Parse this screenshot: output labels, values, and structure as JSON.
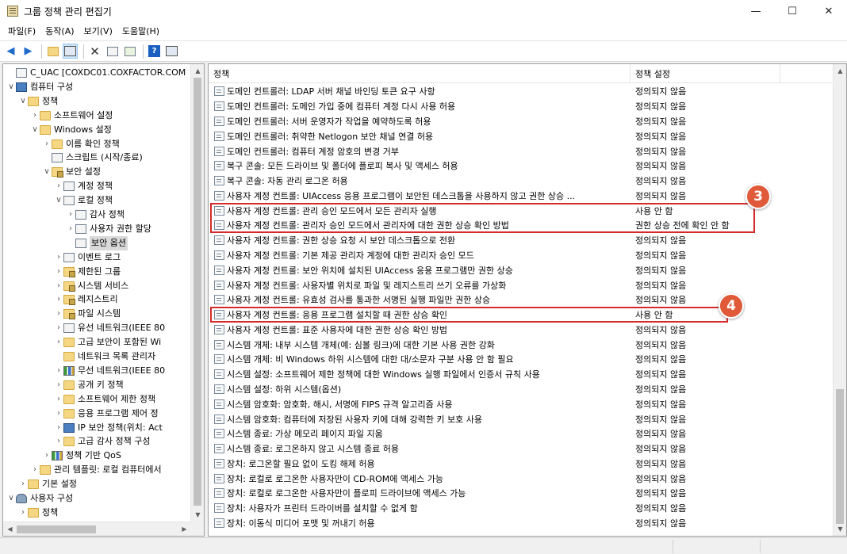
{
  "window": {
    "title": "그룹 정책 관리 편집기",
    "minimize": "—",
    "maximize": "☐",
    "close": "✕"
  },
  "menu": [
    {
      "label": "파일(F)"
    },
    {
      "label": "동작(A)"
    },
    {
      "label": "보기(V)"
    },
    {
      "label": "도움말(H)"
    }
  ],
  "toolbar": {
    "back": "◀",
    "forward": "▶",
    "delete": "✕",
    "help": "?"
  },
  "tree": [
    {
      "label": "C_UAC [COXDC01.COXFACTOR.COM",
      "depth": 0,
      "chevron": "",
      "icon": "sheet"
    },
    {
      "label": "컴퓨터 구성",
      "depth": 0,
      "chevron": "∨",
      "icon": "monitor"
    },
    {
      "label": "정책",
      "depth": 1,
      "chevron": "∨",
      "icon": "folder"
    },
    {
      "label": "소프트웨어 설정",
      "depth": 2,
      "chevron": "›",
      "icon": "folder"
    },
    {
      "label": "Windows 설정",
      "depth": 2,
      "chevron": "∨",
      "icon": "folder"
    },
    {
      "label": "이름 확인 정책",
      "depth": 3,
      "chevron": "›",
      "icon": "folder"
    },
    {
      "label": "스크립트 (시작/종료)",
      "depth": 3,
      "chevron": "",
      "icon": "sheet"
    },
    {
      "label": "보안 설정",
      "depth": 3,
      "chevron": "∨",
      "icon": "folder-lock"
    },
    {
      "label": "계정 정책",
      "depth": 4,
      "chevron": "›",
      "icon": "sheet"
    },
    {
      "label": "로컬 정책",
      "depth": 4,
      "chevron": "∨",
      "icon": "sheet"
    },
    {
      "label": "감사 정책",
      "depth": 5,
      "chevron": "›",
      "icon": "sheet"
    },
    {
      "label": "사용자 권한 할당",
      "depth": 5,
      "chevron": "›",
      "icon": "sheet"
    },
    {
      "label": "보안 옵션",
      "depth": 5,
      "chevron": "",
      "icon": "sheet",
      "selected": true
    },
    {
      "label": "이벤트 로그",
      "depth": 4,
      "chevron": "›",
      "icon": "sheet"
    },
    {
      "label": "제한된 그룹",
      "depth": 4,
      "chevron": "›",
      "icon": "folder-lock"
    },
    {
      "label": "시스템 서비스",
      "depth": 4,
      "chevron": "›",
      "icon": "folder-lock"
    },
    {
      "label": "레지스트리",
      "depth": 4,
      "chevron": "›",
      "icon": "folder-lock"
    },
    {
      "label": "파일 시스템",
      "depth": 4,
      "chevron": "›",
      "icon": "folder-lock"
    },
    {
      "label": "유선 네트워크(IEEE 80",
      "depth": 4,
      "chevron": "›",
      "icon": "sheet"
    },
    {
      "label": "고급 보안이 포함된 Wi",
      "depth": 4,
      "chevron": "›",
      "icon": "folder"
    },
    {
      "label": "네트워크 목록 관리자",
      "depth": 4,
      "chevron": "",
      "icon": "folder"
    },
    {
      "label": "무선 네트워크(IEEE 80",
      "depth": 4,
      "chevron": "›",
      "icon": "chart"
    },
    {
      "label": "공개 키 정책",
      "depth": 4,
      "chevron": "›",
      "icon": "folder"
    },
    {
      "label": "소프트웨어 제한 정책",
      "depth": 4,
      "chevron": "›",
      "icon": "folder"
    },
    {
      "label": "응용 프로그램 제어 정",
      "depth": 4,
      "chevron": "›",
      "icon": "folder"
    },
    {
      "label": "IP 보안 정책(위치: Act",
      "depth": 4,
      "chevron": "›",
      "icon": "monitor"
    },
    {
      "label": "고급 감사 정책 구성",
      "depth": 4,
      "chevron": "›",
      "icon": "folder"
    },
    {
      "label": "정책 기반 QoS",
      "depth": 3,
      "chevron": "›",
      "icon": "chart"
    },
    {
      "label": "관리 템플릿: 로컬 컴퓨터에서",
      "depth": 2,
      "chevron": "›",
      "icon": "folder"
    },
    {
      "label": "기본 설정",
      "depth": 1,
      "chevron": "›",
      "icon": "folder"
    },
    {
      "label": "사용자 구성",
      "depth": 0,
      "chevron": "∨",
      "icon": "person"
    },
    {
      "label": "정책",
      "depth": 1,
      "chevron": "›",
      "icon": "folder"
    },
    {
      "label": "기본 설정",
      "depth": 1,
      "chevron": "›",
      "icon": "folder"
    }
  ],
  "list": {
    "columns": {
      "policy": "정책",
      "setting": "정책 설정"
    },
    "rows": [
      {
        "name": "도메인 컨트롤러: LDAP 서버 채널 바인딩 토큰 요구 사항",
        "setting": "정의되지 않음"
      },
      {
        "name": "도메인 컨트롤러: 도메인 가입 중에 컴퓨터 계정 다시 사용 허용",
        "setting": "정의되지 않음"
      },
      {
        "name": "도메인 컨트롤러: 서버 운영자가 작업을 예약하도록 허용",
        "setting": "정의되지 않음"
      },
      {
        "name": "도메인 컨트롤러: 취약한 Netlogon 보안 채널 연결 허용",
        "setting": "정의되지 않음"
      },
      {
        "name": "도메인 컨트롤러: 컴퓨터 계정 암호의 변경 거부",
        "setting": "정의되지 않음"
      },
      {
        "name": "복구 콘솔: 모든 드라이브 및 폴더에 플로피 복사 및 액세스 허용",
        "setting": "정의되지 않음"
      },
      {
        "name": "복구 콘솔: 자동 관리 로그온 허용",
        "setting": "정의되지 않음"
      },
      {
        "name": "사용자 계정 컨트롤: UIAccess 응용 프로그램이 보안된 데스크톱을 사용하지 않고 권한 상승 ...",
        "setting": "정의되지 않음"
      },
      {
        "name": "사용자 계정 컨트롤: 관리 승인 모드에서 모든 관리자 실행",
        "setting": "사용 안 함"
      },
      {
        "name": "사용자 계정 컨트롤: 관리자 승인 모드에서 관리자에 대한 권한 상승 확인 방법",
        "setting": "권한 상승 전에 확인 안 함"
      },
      {
        "name": "사용자 계정 컨트롤: 권한 상승 요청 시 보안 데스크톱으로 전환",
        "setting": "정의되지 않음"
      },
      {
        "name": "사용자 계정 컨트롤: 기본 제공 관리자 계정에 대한 관리자 승인 모드",
        "setting": "정의되지 않음"
      },
      {
        "name": "사용자 계정 컨트롤: 보안 위치에 설치된 UIAccess 응용 프로그램만 권한 상승",
        "setting": "정의되지 않음"
      },
      {
        "name": "사용자 계정 컨트롤: 사용자별 위치로 파일 및 레지스트리 쓰기 오류를 가상화",
        "setting": "정의되지 않음"
      },
      {
        "name": "사용자 계정 컨트롤: 유효성 검사를 통과한 서명된 실행 파일만 권한 상승",
        "setting": "정의되지 않음"
      },
      {
        "name": "사용자 계정 컨트롤: 응용 프로그램 설치할 때 권한 상승 확인",
        "setting": "사용 안 함"
      },
      {
        "name": "사용자 계정 컨트롤: 표준 사용자에 대한 권한 상승 확인 방법",
        "setting": "정의되지 않음"
      },
      {
        "name": "시스템 개체: 내부 시스템 개체(예: 심볼 링크)에 대한 기본 사용 권한 강화",
        "setting": "정의되지 않음"
      },
      {
        "name": "시스템 개체: 비 Windows 하위 시스템에 대한 대/소문자 구분 사용 안 함 필요",
        "setting": "정의되지 않음"
      },
      {
        "name": "시스템 설정: 소프트웨어 제한 정책에 대한 Windows 실행 파일에서 인증서 규칙 사용",
        "setting": "정의되지 않음"
      },
      {
        "name": "시스템 설정: 하위 시스템(옵션)",
        "setting": "정의되지 않음"
      },
      {
        "name": "시스템 암호화: 암호화, 해시, 서명에 FIPS 규격 알고리즘 사용",
        "setting": "정의되지 않음"
      },
      {
        "name": "시스템 암호화: 컴퓨터에 저장된 사용자 키에 대해 강력한 키 보호 사용",
        "setting": "정의되지 않음"
      },
      {
        "name": "시스템 종료: 가상 메모리 페이지 파일 지움",
        "setting": "정의되지 않음"
      },
      {
        "name": "시스템 종료: 로그온하지 않고 시스템 종료 허용",
        "setting": "정의되지 않음"
      },
      {
        "name": "장치: 로그온할 필요 없이 도킹 해제 허용",
        "setting": "정의되지 않음"
      },
      {
        "name": "장치: 로컬로 로그온한 사용자만이 CD-ROM에 액세스 가능",
        "setting": "정의되지 않음"
      },
      {
        "name": "장치: 로컬로 로그온한 사용자만이 플로피 드라이브에 액세스 가능",
        "setting": "정의되지 않음"
      },
      {
        "name": "장치: 사용자가 프린터 드라이버를 설치할 수 없게 함",
        "setting": "정의되지 않음"
      },
      {
        "name": "장치: 이동식 미디어 포맷 및 꺼내기 허용",
        "setting": "정의되지 않음"
      }
    ]
  },
  "callouts": [
    {
      "number": "3"
    },
    {
      "number": "4"
    }
  ],
  "colors": {
    "highlight": "#d42a2a",
    "badge": "#e05a3a"
  }
}
